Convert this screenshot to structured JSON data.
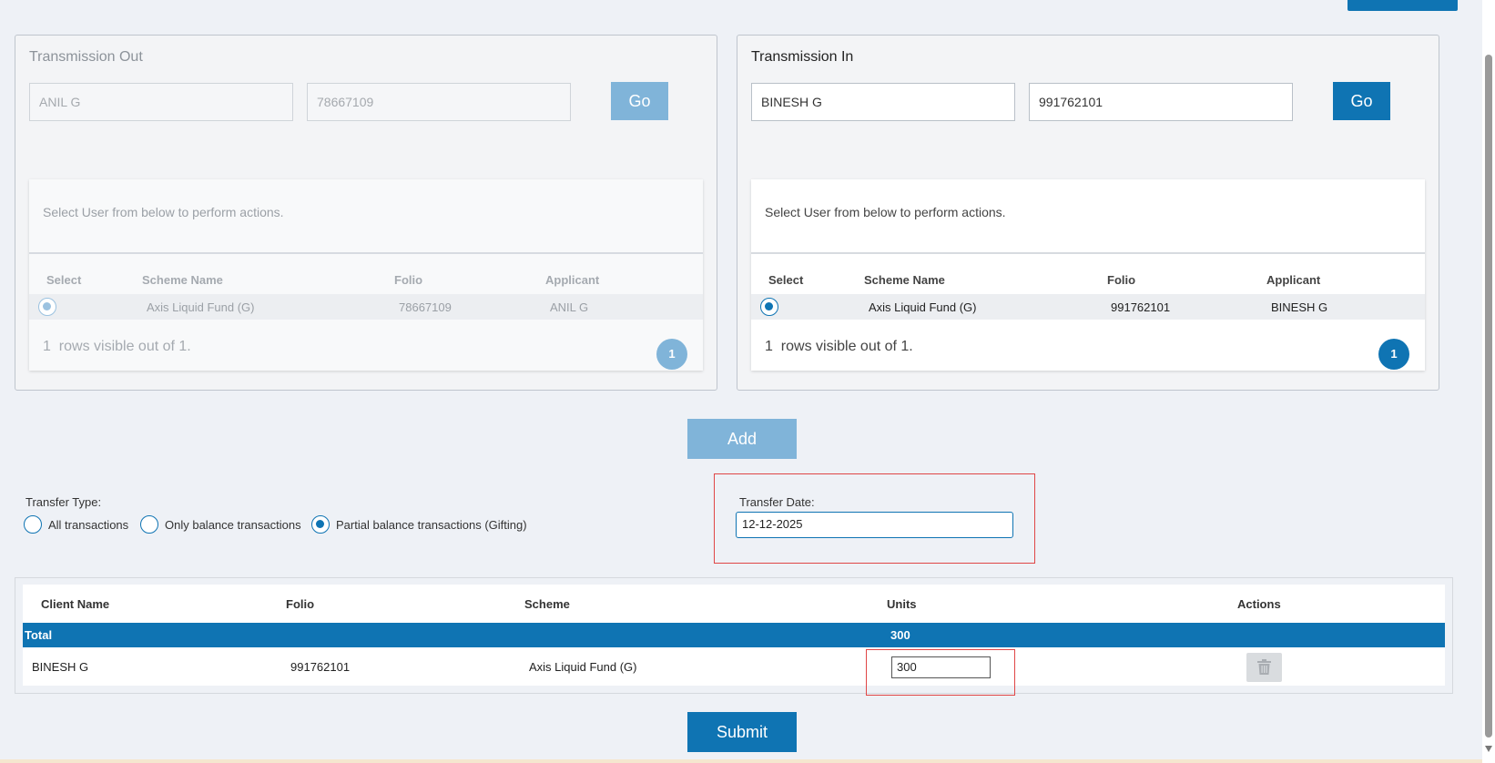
{
  "transmission_out": {
    "title": "Transmission Out",
    "name_value": "ANIL G",
    "folio_value": "78667109",
    "go_label": "Go",
    "grid": {
      "message": "Select User from below to perform actions.",
      "headers": [
        "Select",
        "Scheme Name",
        "Folio",
        "Applicant"
      ],
      "row": {
        "scheme": "Axis Liquid Fund (G)",
        "folio": "78667109",
        "applicant": "ANIL G"
      },
      "rows_count": "1",
      "rows_info": "rows visible out of 1.",
      "page": "1"
    }
  },
  "transmission_in": {
    "title": "Transmission In",
    "name_value": "BINESH G",
    "folio_value": "991762101",
    "go_label": "Go",
    "grid": {
      "message": "Select User from below to perform actions.",
      "headers": [
        "Select",
        "Scheme Name",
        "Folio",
        "Applicant"
      ],
      "row": {
        "scheme": "Axis Liquid Fund (G)",
        "folio": "991762101",
        "applicant": "BINESH G"
      },
      "rows_count": "1",
      "rows_info": "rows visible out of 1.",
      "page": "1"
    }
  },
  "add_label": "Add",
  "transfer_type": {
    "label": "Transfer Type:",
    "options": [
      "All transactions",
      "Only balance transactions",
      "Partial balance transactions (Gifting)"
    ],
    "selected": "Partial balance transactions (Gifting)"
  },
  "transfer_date": {
    "label": "Transfer Date:",
    "value": "12-12-2025"
  },
  "table": {
    "headers": [
      "Client Name",
      "Folio",
      "Scheme",
      "Units",
      "Actions"
    ],
    "total_label": "Total",
    "total_units": "300",
    "row": {
      "client": "BINESH G",
      "folio": "991762101",
      "scheme": "Axis Liquid Fund (G)",
      "units": "300"
    }
  },
  "submit_label": "Submit",
  "colors": {
    "primary": "#0f74b3",
    "primary_disabled": "#80b4d9",
    "highlight": "#e04646"
  }
}
